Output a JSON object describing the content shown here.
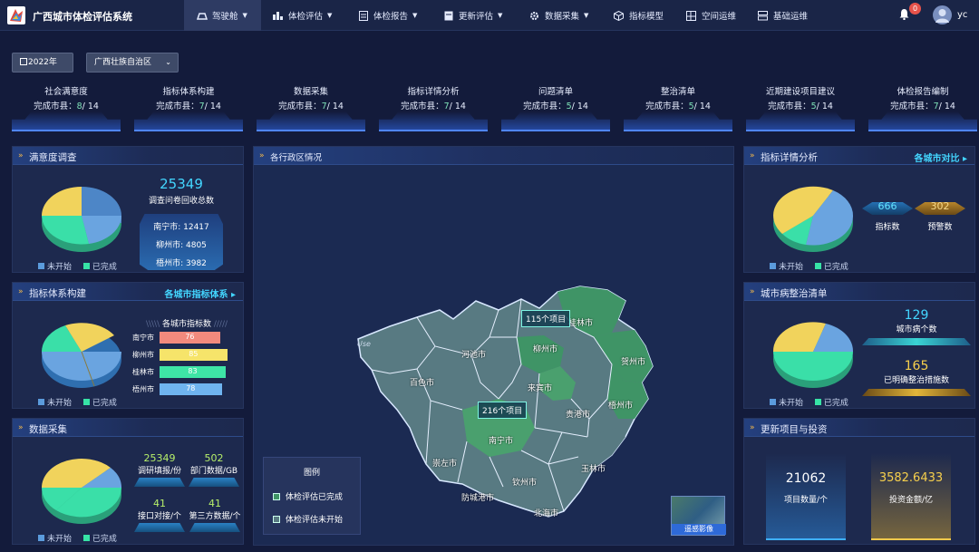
{
  "app": {
    "title": "广西城市体检评估系统",
    "user": "yc",
    "notifications": "0"
  },
  "nav": [
    {
      "label": "驾驶舱",
      "dropdown": true,
      "active": true,
      "icon": "steering-icon"
    },
    {
      "label": "体检评估",
      "dropdown": true,
      "icon": "chart-icon"
    },
    {
      "label": "体检报告",
      "dropdown": true,
      "icon": "report-icon"
    },
    {
      "label": "更新评估",
      "dropdown": true,
      "icon": "update-icon"
    },
    {
      "label": "数据采集",
      "dropdown": true,
      "icon": "gear-icon"
    },
    {
      "label": "指标模型",
      "dropdown": false,
      "icon": "cube-icon"
    },
    {
      "label": "空间运维",
      "dropdown": false,
      "icon": "map-icon"
    },
    {
      "label": "基础运维",
      "dropdown": false,
      "icon": "server-icon"
    }
  ],
  "filters": {
    "year": "2022年",
    "region": "广西壮族自治区"
  },
  "stats": [
    {
      "title": "社会满意度",
      "prefix": "完成市县：",
      "done": "8",
      "total": "/ 14"
    },
    {
      "title": "指标体系构建",
      "prefix": "完成市县：",
      "done": "7",
      "total": "/ 14"
    },
    {
      "title": "数据采集",
      "prefix": "完成市县：",
      "done": "7",
      "total": "/ 14"
    },
    {
      "title": "指标详情分析",
      "prefix": "完成市县：",
      "done": "7",
      "total": "/ 14"
    },
    {
      "title": "问题清单",
      "prefix": "完成市县：",
      "done": "5",
      "total": "/ 14"
    },
    {
      "title": "整治清单",
      "prefix": "完成市县：",
      "done": "5",
      "total": "/ 14"
    },
    {
      "title": "近期建设项目建议",
      "prefix": "完成市县：",
      "done": "5",
      "total": "/ 14"
    },
    {
      "title": "体检报告编制",
      "prefix": "完成市县：",
      "done": "7",
      "total": "/ 14"
    }
  ],
  "legend": {
    "not_started": "未开始",
    "completed": "已完成"
  },
  "colors": {
    "not_started": "#5b9bdc",
    "completed": "#37e3a6",
    "pie_yellow": "#f1d35c",
    "pie_blue": "#6aa4e0",
    "pie_green": "#3adfa8"
  },
  "satisfaction": {
    "title": "满意度调查",
    "total": "25349",
    "total_label": "调查问卷回收总数",
    "cities": [
      "南宁市: 12417",
      "柳州市: 4805",
      "梧州市: 3982"
    ]
  },
  "indicator_system": {
    "title": "指标体系构建",
    "link": "各城市指标体系",
    "bar_title": "各城市指标数",
    "bars": [
      {
        "city": "南宁市",
        "value": 76,
        "color": "#f28a7d"
      },
      {
        "city": "柳州市",
        "value": 85,
        "color": "#f6e46a"
      },
      {
        "city": "桂林市",
        "value": 83,
        "color": "#3ee5a6"
      },
      {
        "city": "梧州市",
        "value": 78,
        "color": "#6fb4f0"
      }
    ]
  },
  "data_collect": {
    "title": "数据采集",
    "items": [
      {
        "value": "25349",
        "label": "调研填报/份"
      },
      {
        "value": "502",
        "label": "部门数据/GB"
      },
      {
        "value": "41",
        "label": "接口对接/个"
      },
      {
        "value": "41",
        "label": "第三方数据/个"
      }
    ]
  },
  "map": {
    "title": "各行政区情况",
    "cities": [
      "河池市",
      "柳州市",
      "桂林市",
      "贺州市",
      "百色市",
      "来宾市",
      "梧州市",
      "贵港市",
      "南宁市",
      "崇左市",
      "玉林市",
      "钦州市",
      "防城港市",
      "北海市"
    ],
    "projects": [
      "115个项目",
      "216个项目"
    ],
    "legend_title": "图例",
    "legend_done": "体检评估已完成",
    "legend_todo": "体检评估未开始",
    "remote_label": "遥感影像",
    "watermark": "Use"
  },
  "indicator_detail": {
    "title": "指标详情分析",
    "link": "各城市对比",
    "count": "666",
    "count_label": "指标数",
    "warn": "302",
    "warn_label": "预警数"
  },
  "city_disease": {
    "title": "城市病整治清单",
    "count": "129",
    "count_label": "城市病个数",
    "measures": "165",
    "measures_label": "已明确整治措施数"
  },
  "projects": {
    "title": "更新项目与投资",
    "count": "21062",
    "count_label": "项目数量/个",
    "amount": "3582.6433",
    "amount_label": "投资金额/亿"
  }
}
